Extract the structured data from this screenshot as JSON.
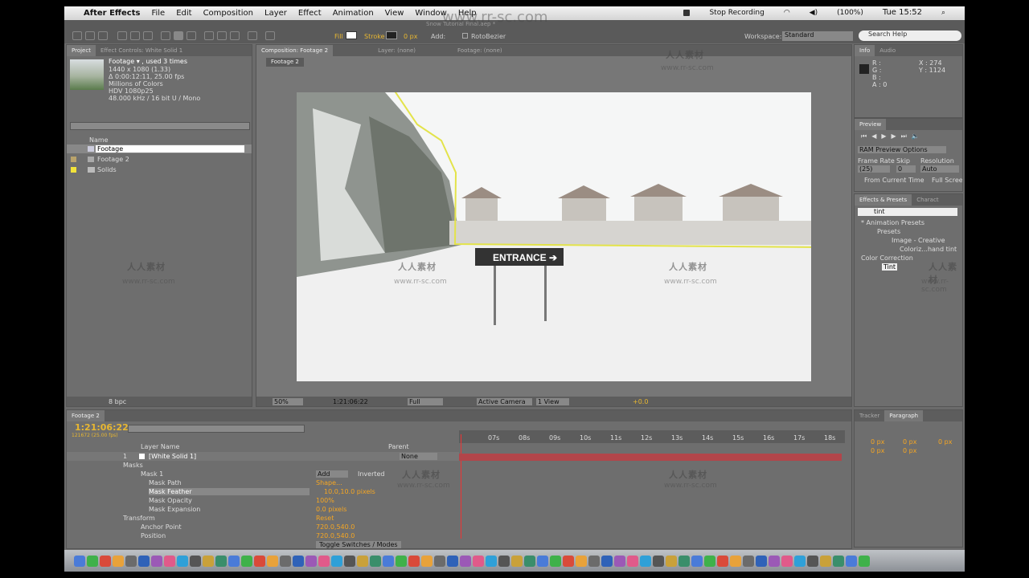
{
  "menubar": {
    "app": "After Effects",
    "items": [
      "File",
      "Edit",
      "Composition",
      "Layer",
      "Effect",
      "Animation",
      "View",
      "Window",
      "Help"
    ],
    "stop_recording": "Stop Recording",
    "battery": "(100%)",
    "clock": "Tue 15:52"
  },
  "toolbar": {
    "window_title": "Snow Tutorial Final.aep *",
    "fill": "Fill",
    "stroke": "Stroke",
    "stroke_px": "0 px",
    "add": "Add:",
    "rotobezier": "RotoBezier",
    "workspace_label": "Workspace:",
    "workspace_value": "Standard",
    "search_help": "Search Help"
  },
  "project": {
    "tab_project": "Project",
    "tab_effect": "Effect Controls: White Solid 1",
    "info_name": "Footage ▾ , used 3 times",
    "info_lines": [
      "1440 x 1080 (1.33)",
      "Δ 0:00:12:11, 25.00 fps",
      "Millions of Colors",
      "HDV 1080p25",
      "48.000 kHz / 16 bit U / Mono"
    ],
    "col_name": "Name",
    "items": [
      "Footage",
      "Footage 2",
      "Solids"
    ],
    "bpc": "8 bpc"
  },
  "composition": {
    "tab_comp": "Composition: Footage 2",
    "tab_layer": "Layer: (none)",
    "tab_footage": "Footage: (none)",
    "subtab": "Footage 2",
    "sign_text": "ENTRANCE ➔",
    "zoom": "50%",
    "timecode": "1:21:06:22",
    "resolution": "Full",
    "camera": "Active Camera",
    "views": "1 View",
    "exposure": "+0.0"
  },
  "info_panel": {
    "tab_info": "Info",
    "tab_audio": "Audio",
    "r": "R :",
    "g": "G :",
    "b": "B :",
    "a": "A : 0",
    "x": "X : 274",
    "y": "Y : 1124"
  },
  "preview_panel": {
    "title": "Preview",
    "ram": "RAM Preview Options",
    "frame_rate_label": "Frame Rate",
    "skip_label": "Skip",
    "resolution_label": "Resolution",
    "frame_rate": "(25)",
    "skip": "0",
    "resolution": "Auto",
    "from_current": "From Current Time",
    "full_screen": "Full Screen"
  },
  "effects_panel": {
    "tab_effects": "Effects & Presets",
    "tab_char": "Charact",
    "search": "tint",
    "tree": [
      "* Animation Presets",
      "Presets",
      "Image - Creative",
      "Coloriz...hand tint",
      "Color Correction",
      "Tint"
    ]
  },
  "paragraph_panel": {
    "tab_tracker": "Tracker",
    "tab_paragraph": "Paragraph",
    "v1": "0 px",
    "v2": "0 px",
    "v3": "0 px",
    "v4": "0 px",
    "v5": "0 px"
  },
  "timeline": {
    "tab": "Footage 2",
    "timecode": "1:21:06:22",
    "frame": "121672 (25.00 fps)",
    "col_layer": "Layer Name",
    "col_parent": "Parent",
    "ticks": [
      "07s",
      "08s",
      "09s",
      "10s",
      "11s",
      "12s",
      "13s",
      "14s",
      "15s",
      "16s",
      "17s",
      "18s"
    ],
    "layer_num": "1",
    "layer_name": "[White Solid 1]",
    "parent_val": "None",
    "props": [
      {
        "name": "Masks",
        "value": ""
      },
      {
        "name": "Mask 1",
        "value": "Add"
      },
      {
        "name": "Mask Path",
        "value": "Shape..."
      },
      {
        "name": "Mask Feather",
        "value": "10.0,10.0 pixels"
      },
      {
        "name": "Mask Opacity",
        "value": "100%"
      },
      {
        "name": "Mask Expansion",
        "value": "0.0 pixels"
      },
      {
        "name": "Transform",
        "value": "Reset"
      },
      {
        "name": "Anchor Point",
        "value": "720.0,540.0"
      },
      {
        "name": "Position",
        "value": "720.0,540.0"
      }
    ],
    "inverted": "Inverted",
    "toggle": "Toggle Switches / Modes"
  },
  "watermark": {
    "url": "www.rr-sc.com",
    "cn": "人人素材"
  }
}
